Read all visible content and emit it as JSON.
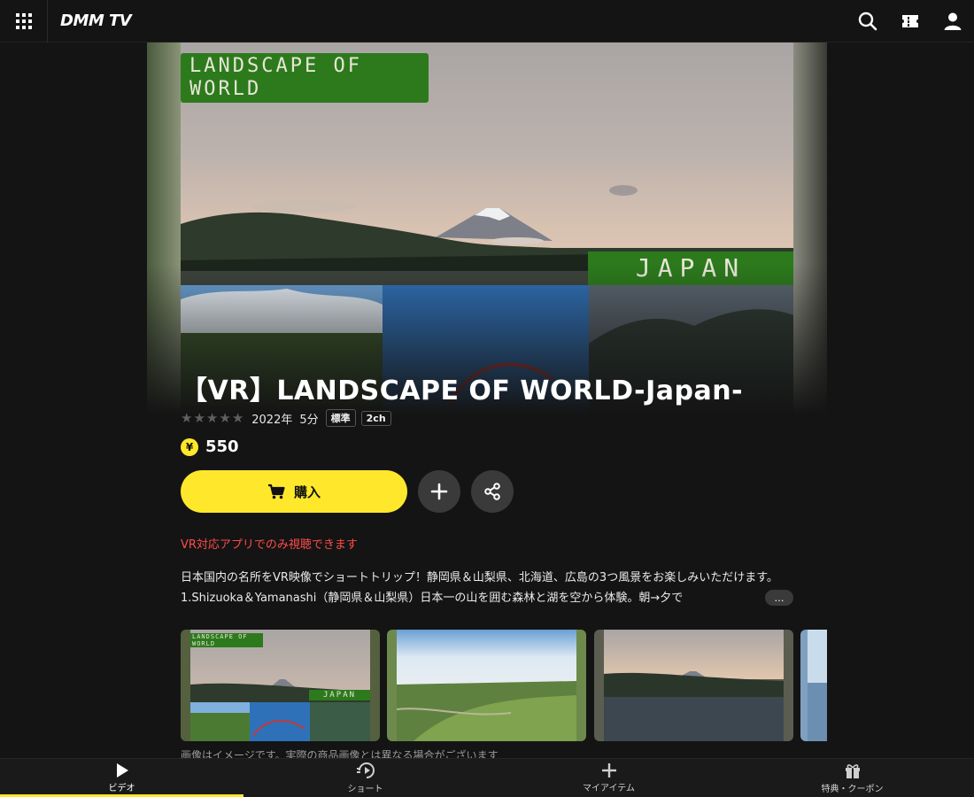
{
  "header": {
    "logo": "DMM TV"
  },
  "hero": {
    "badge_title": "LANDSCAPE OF WORLD",
    "badge_country": "JAPAN"
  },
  "title": "【VR】LANDSCAPE OF WORLD-Japan-",
  "meta": {
    "rating": 0,
    "max_rating": 5,
    "year": "2022年",
    "duration": "5分",
    "tag_quality": "標準",
    "tag_audio": "2ch"
  },
  "price": {
    "currency_icon": "¥",
    "value": "550"
  },
  "buttons": {
    "buy_label": "購入"
  },
  "vr_note": "VR対応アプリでのみ視聴できます",
  "description": "日本国内の名所をVR映像でショートトリップ！静岡県＆山梨県、北海道、広島の3つ風景をお楽しみいただけます。1.Shizuoka＆Yamanashi（静岡県＆山梨県）日本一の山を囲む森林と湖を空から体験。朝→夕で",
  "more_label": "…",
  "thumbnails": {
    "t1_badge": "LANDSCAPE OF WORLD",
    "t1_country": "JAPAN"
  },
  "disclaimer": "画像はイメージです。実際の商品画像とは異なる場合がございます",
  "bottom_nav": [
    {
      "label": "ビデオ",
      "icon": "play-icon"
    },
    {
      "label": "ショート",
      "icon": "short-play-icon"
    },
    {
      "label": "マイアイテム",
      "icon": "plus-icon"
    },
    {
      "label": "特典・クーポン",
      "icon": "gift-icon"
    }
  ],
  "colors": {
    "accent": "#ffe82b",
    "background": "#141414",
    "warning": "#ff4b4b",
    "badge_green": "#2c7a1c"
  }
}
